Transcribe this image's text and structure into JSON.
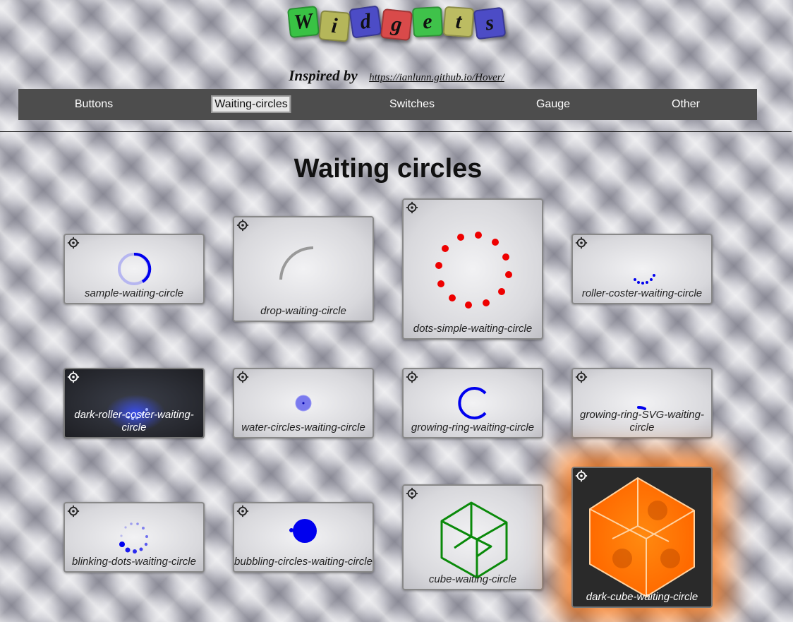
{
  "logo": {
    "letters": [
      "W",
      "i",
      "d",
      "g",
      "e",
      "t",
      "s"
    ],
    "colors": [
      "#39c244",
      "#b5b65a",
      "#4c4cc6",
      "#d94a4a",
      "#3fc24a",
      "#bcbc62",
      "#4c4cc6"
    ]
  },
  "inspired": {
    "label": "Inspired by",
    "link": "https://ianlunn.github.io/Hover/"
  },
  "nav": {
    "items": [
      "Buttons",
      "Waiting-circles",
      "Switches",
      "Gauge",
      "Other"
    ],
    "active": "Waiting-circles"
  },
  "page_title": "Waiting circles",
  "cards": {
    "sample": "sample-waiting-circle",
    "drop": "drop-waiting-circle",
    "dots_simple": "dots-simple-waiting-circle",
    "roller_coster": "roller-coster-waiting-circle",
    "dark_roller_coster": "dark-roller-coster-waiting-circle",
    "water_circles": "water-circles-waiting-circle",
    "growing_ring": "growing-ring-waiting-circle",
    "growing_ring_svg": "growing-ring-SVG-waiting-circle",
    "blinking_dots": "blinking-dots-waiting-circle",
    "bubbling_circles": "bubbling-circles-waiting-circle",
    "cube": "cube-waiting-circle",
    "dark_cube": "dark-cube-waiting-circle"
  },
  "colors": {
    "accent_blue": "#0000ee",
    "dot_red": "#ee0000",
    "cube_green": "#0a8a0a",
    "glow_orange": "#ff7a00",
    "nav_bg": "#4d4d4d"
  },
  "icons": {
    "settings": "gear-icon"
  }
}
